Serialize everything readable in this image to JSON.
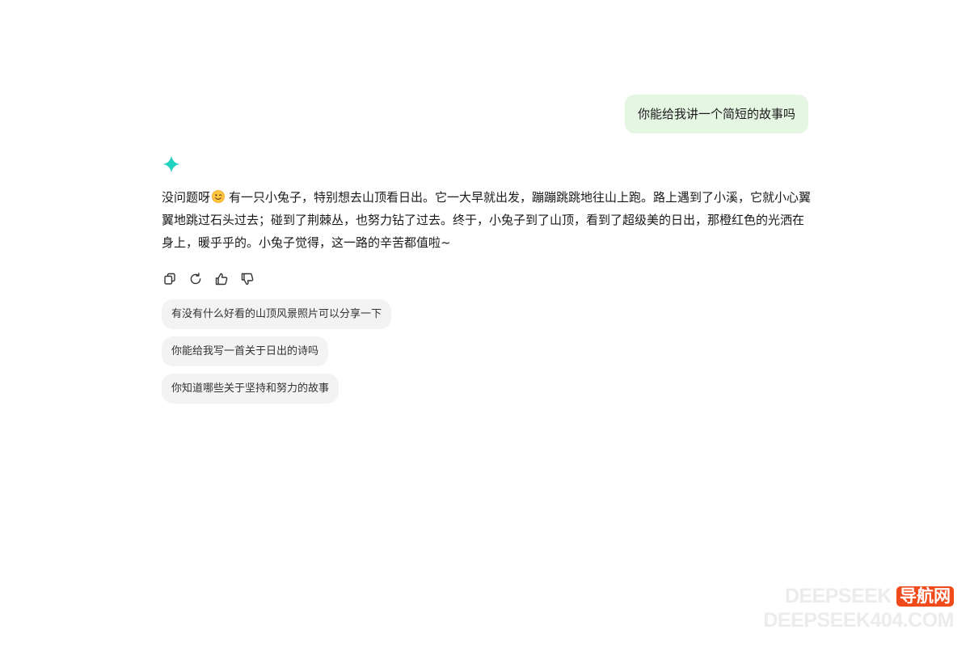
{
  "user_message": "你能给我讲一个简短的故事吗",
  "assistant": {
    "text_before_emoji": "没问题呀",
    "text_after_emoji": "有一只小兔子，特别想去山顶看日出。它一大早就出发，蹦蹦跳跳地往山上跑。路上遇到了小溪，它就小心翼翼地跳过石头过去；碰到了荆棘丛，也努力钻了过去。终于，小兔子到了山顶，看到了超级美的日出，那橙红色的光洒在身上，暖乎乎的。小兔子觉得，这一路的辛苦都值啦~",
    "avatar_icon": "sparkle-icon",
    "emoji_icon": "winking-face-icon"
  },
  "actions": [
    {
      "name": "copy",
      "icon": "copy-icon"
    },
    {
      "name": "regenerate",
      "icon": "refresh-icon"
    },
    {
      "name": "like",
      "icon": "thumbs-up-icon"
    },
    {
      "name": "dislike",
      "icon": "thumbs-down-icon"
    }
  ],
  "suggestions": [
    "有没有什么好看的山顶风景照片可以分享一下",
    "你能给我写一首关于日出的诗吗",
    "你知道哪些关于坚持和努力的故事"
  ],
  "watermark": {
    "brand": "DEEPSEEK",
    "badge": "导航网",
    "domain": "DEEPSEEK404.COM"
  },
  "colors": {
    "user_bubble": "#e5f6e3",
    "avatar_accent": "#22d3c0",
    "suggestion_bg": "#f3f3f4",
    "watermark_badge": "#f04a1a"
  }
}
